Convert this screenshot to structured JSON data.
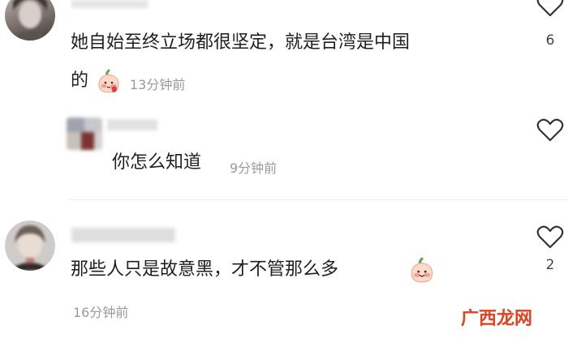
{
  "comments": [
    {
      "text_line1": "她自始至终立场都很坚定，就是台湾是中国",
      "text_line2": "的",
      "emoji": "blush-peach-emoji",
      "time": "13分钟前",
      "likes": "6"
    },
    {
      "text": "你怎么知道",
      "time": "9分钟前",
      "likes": ""
    },
    {
      "text": "那些人只是故意黑，才不管那么多",
      "emoji": "blush-peach-emoji",
      "time": "16分钟前",
      "likes": "2"
    }
  ],
  "watermark": {
    "text": "广西龙网",
    "color_primary": "#e2421f"
  },
  "colors": {
    "text": "#1f1f1f",
    "meta": "#9a9a9a",
    "divider": "#ececec"
  },
  "icons": {
    "like": "heart-outline-icon"
  }
}
